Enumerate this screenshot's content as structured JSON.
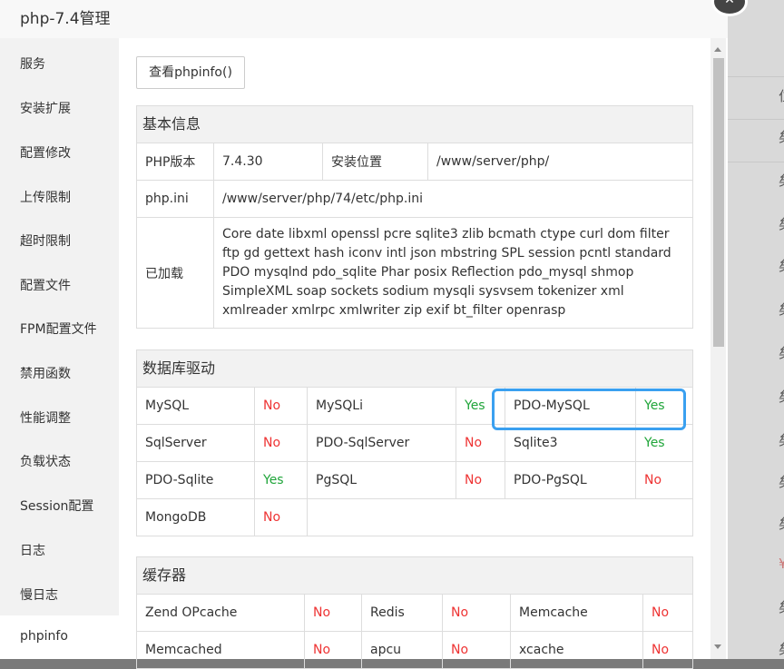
{
  "modal": {
    "title": "php-7.4管理",
    "close_icon": "close-icon"
  },
  "sidebar": {
    "items": [
      {
        "label": "服务"
      },
      {
        "label": "安装扩展"
      },
      {
        "label": "配置修改"
      },
      {
        "label": "上传限制"
      },
      {
        "label": "超时限制"
      },
      {
        "label": "配置文件"
      },
      {
        "label": "FPM配置文件"
      },
      {
        "label": "禁用函数"
      },
      {
        "label": "性能调整"
      },
      {
        "label": "负载状态"
      },
      {
        "label": "Session配置"
      },
      {
        "label": "日志"
      },
      {
        "label": "慢日志"
      },
      {
        "label": "phpinfo"
      }
    ],
    "active": "phpinfo"
  },
  "toolbar": {
    "view_phpinfo_label": "查看phpinfo()"
  },
  "basic_info": {
    "title": "基本信息",
    "php_version_label": "PHP版本",
    "php_version_value": "7.4.30",
    "install_path_label": "安装位置",
    "install_path_value": "/www/server/php/",
    "php_ini_label": "php.ini",
    "php_ini_value": "/www/server/php/74/etc/php.ini",
    "loaded_label": "已加载",
    "loaded_value": "Core date libxml openssl pcre sqlite3 zlib bcmath ctype curl dom filter ftp gd gettext hash iconv intl json mbstring SPL session pcntl standard PDO mysqlnd pdo_sqlite Phar posix Reflection pdo_mysql shmop SimpleXML soap sockets sodium mysqli sysvsem tokenizer xml xmlreader xmlrpc xmlwriter zip exif bt_filter openrasp"
  },
  "db_drivers": {
    "title": "数据库驱动",
    "rows": [
      [
        {
          "name": "MySQL",
          "status": "No"
        },
        {
          "name": "MySQLi",
          "status": "Yes"
        },
        {
          "name": "PDO-MySQL",
          "status": "Yes"
        }
      ],
      [
        {
          "name": "SqlServer",
          "status": "No"
        },
        {
          "name": "PDO-SqlServer",
          "status": "No"
        },
        {
          "name": "Sqlite3",
          "status": "Yes"
        }
      ],
      [
        {
          "name": "PDO-Sqlite",
          "status": "Yes"
        },
        {
          "name": "PgSQL",
          "status": "No"
        },
        {
          "name": "PDO-PgSQL",
          "status": "No"
        }
      ],
      [
        {
          "name": "MongoDB",
          "status": "No"
        }
      ]
    ]
  },
  "cache": {
    "title": "缓存器",
    "rows": [
      [
        {
          "name": "Zend OPcache",
          "status": "No"
        },
        {
          "name": "Redis",
          "status": "No"
        },
        {
          "name": "Memcache",
          "status": "No"
        }
      ],
      [
        {
          "name": "Memcached",
          "status": "No"
        },
        {
          "name": "apcu",
          "status": "No"
        },
        {
          "name": "xcache",
          "status": "No"
        }
      ]
    ]
  },
  "background": {
    "cells": [
      "位",
      "矣",
      "矣",
      "矣",
      "矣",
      "矣",
      "矣",
      "矣",
      "矣",
      "矣",
      "矣",
      "¥",
      "矣",
      "矣"
    ]
  },
  "colors": {
    "yes": "#20a53a",
    "no": "#e33333",
    "highlight": "#3aa0f0"
  }
}
